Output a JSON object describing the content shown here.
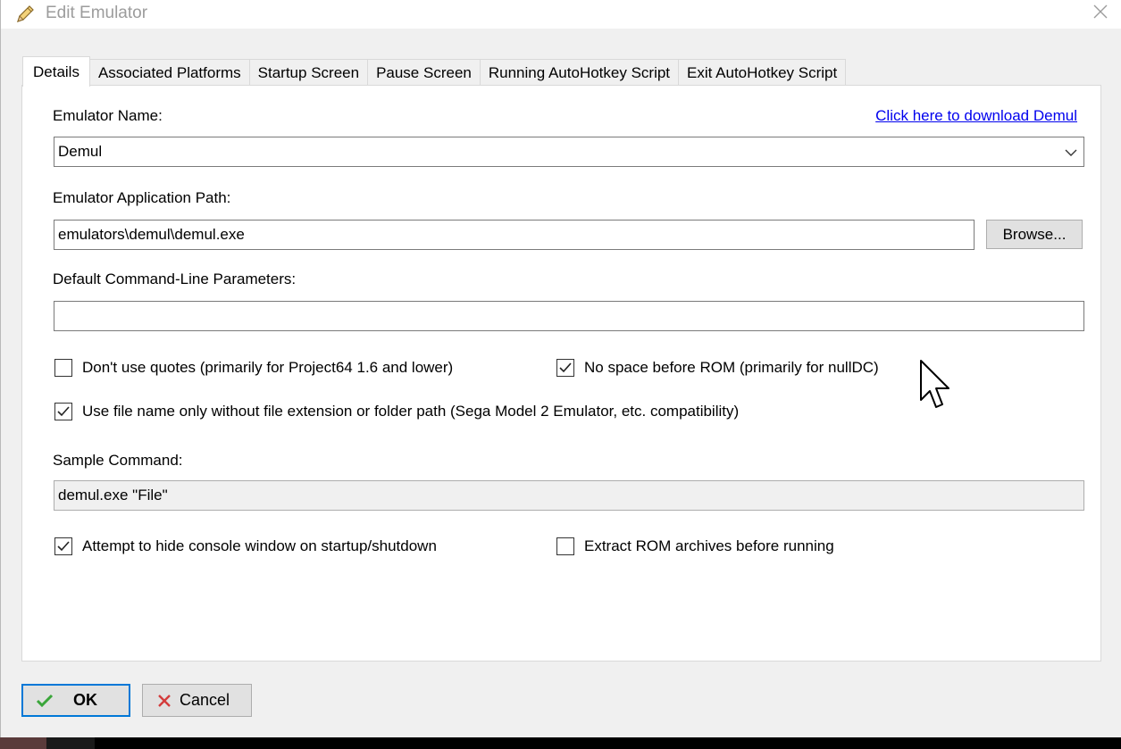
{
  "window": {
    "title": "Edit Emulator",
    "title_icon": "pencil-icon",
    "close_icon": "close-icon"
  },
  "tabs": [
    {
      "label": "Details",
      "active": true
    },
    {
      "label": "Associated Platforms",
      "active": false
    },
    {
      "label": "Startup Screen",
      "active": false
    },
    {
      "label": "Pause Screen",
      "active": false
    },
    {
      "label": "Running AutoHotkey Script",
      "active": false
    },
    {
      "label": "Exit AutoHotkey Script",
      "active": false
    }
  ],
  "details": {
    "name_label": "Emulator Name:",
    "download_link": "Click here to download Demul",
    "name_value": "Demul",
    "path_label": "Emulator Application Path:",
    "path_value": "emulators\\demul\\demul.exe",
    "browse_label": "Browse...",
    "params_label": "Default Command-Line Parameters:",
    "params_value": "",
    "options": {
      "no_quotes": {
        "label": "Don't use quotes (primarily for Project64 1.6 and lower)",
        "checked": false
      },
      "no_space": {
        "label": "No space before ROM (primarily for nullDC)",
        "checked": true
      },
      "file_name_only": {
        "label": "Use file name only without file extension or folder path (Sega Model 2 Emulator, etc. compatibility)",
        "checked": true
      },
      "hide_console": {
        "label": "Attempt to hide console window on startup/shutdown",
        "checked": true
      },
      "extract_rom": {
        "label": "Extract ROM archives before running",
        "checked": false
      }
    },
    "sample_label": "Sample Command:",
    "sample_value": "demul.exe \"File\""
  },
  "footer": {
    "ok_label": "OK",
    "cancel_label": "Cancel"
  },
  "colors": {
    "accent": "#0078d7",
    "link": "#0000ee",
    "ok_check": "#3aa63a",
    "cancel_x": "#d43c3c"
  }
}
